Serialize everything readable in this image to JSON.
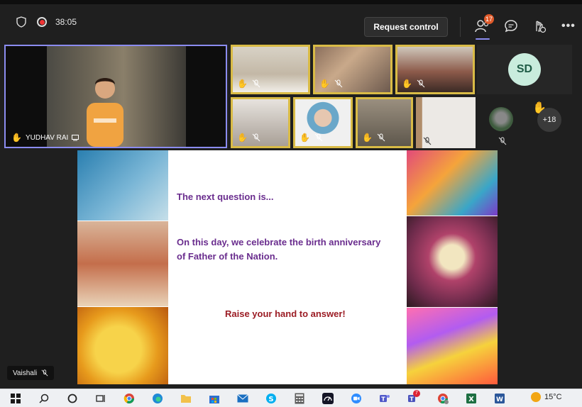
{
  "meeting": {
    "timer": "38:05",
    "request_control_label": "Request control",
    "participants_badge": "17",
    "more_label": "•••"
  },
  "main_video": {
    "name": "YUDHAV RAI"
  },
  "sd_tile": {
    "initials": "SD"
  },
  "overflow": {
    "count_label": "+18"
  },
  "slide": {
    "line1": "The next question is...",
    "line2": "On this day, we celebrate the birth anniversary of Father of the Nation.",
    "line3": "Raise your hand to answer!"
  },
  "presenter_tag": {
    "name": "Vaishali"
  },
  "taskbar": {
    "temperature": "15°C",
    "teams_badge": "7"
  },
  "icons": [
    "shield-icon",
    "record-icon",
    "participants-icon",
    "chat-icon",
    "reactions-icon",
    "more-icon",
    "raise-hand-icon",
    "mic-off-icon"
  ],
  "colors": {
    "accent": "#8b8cf0",
    "thumb_border": "#d9bb46",
    "question_purple": "#6a2d8e",
    "answer_red": "#9b1c24"
  }
}
